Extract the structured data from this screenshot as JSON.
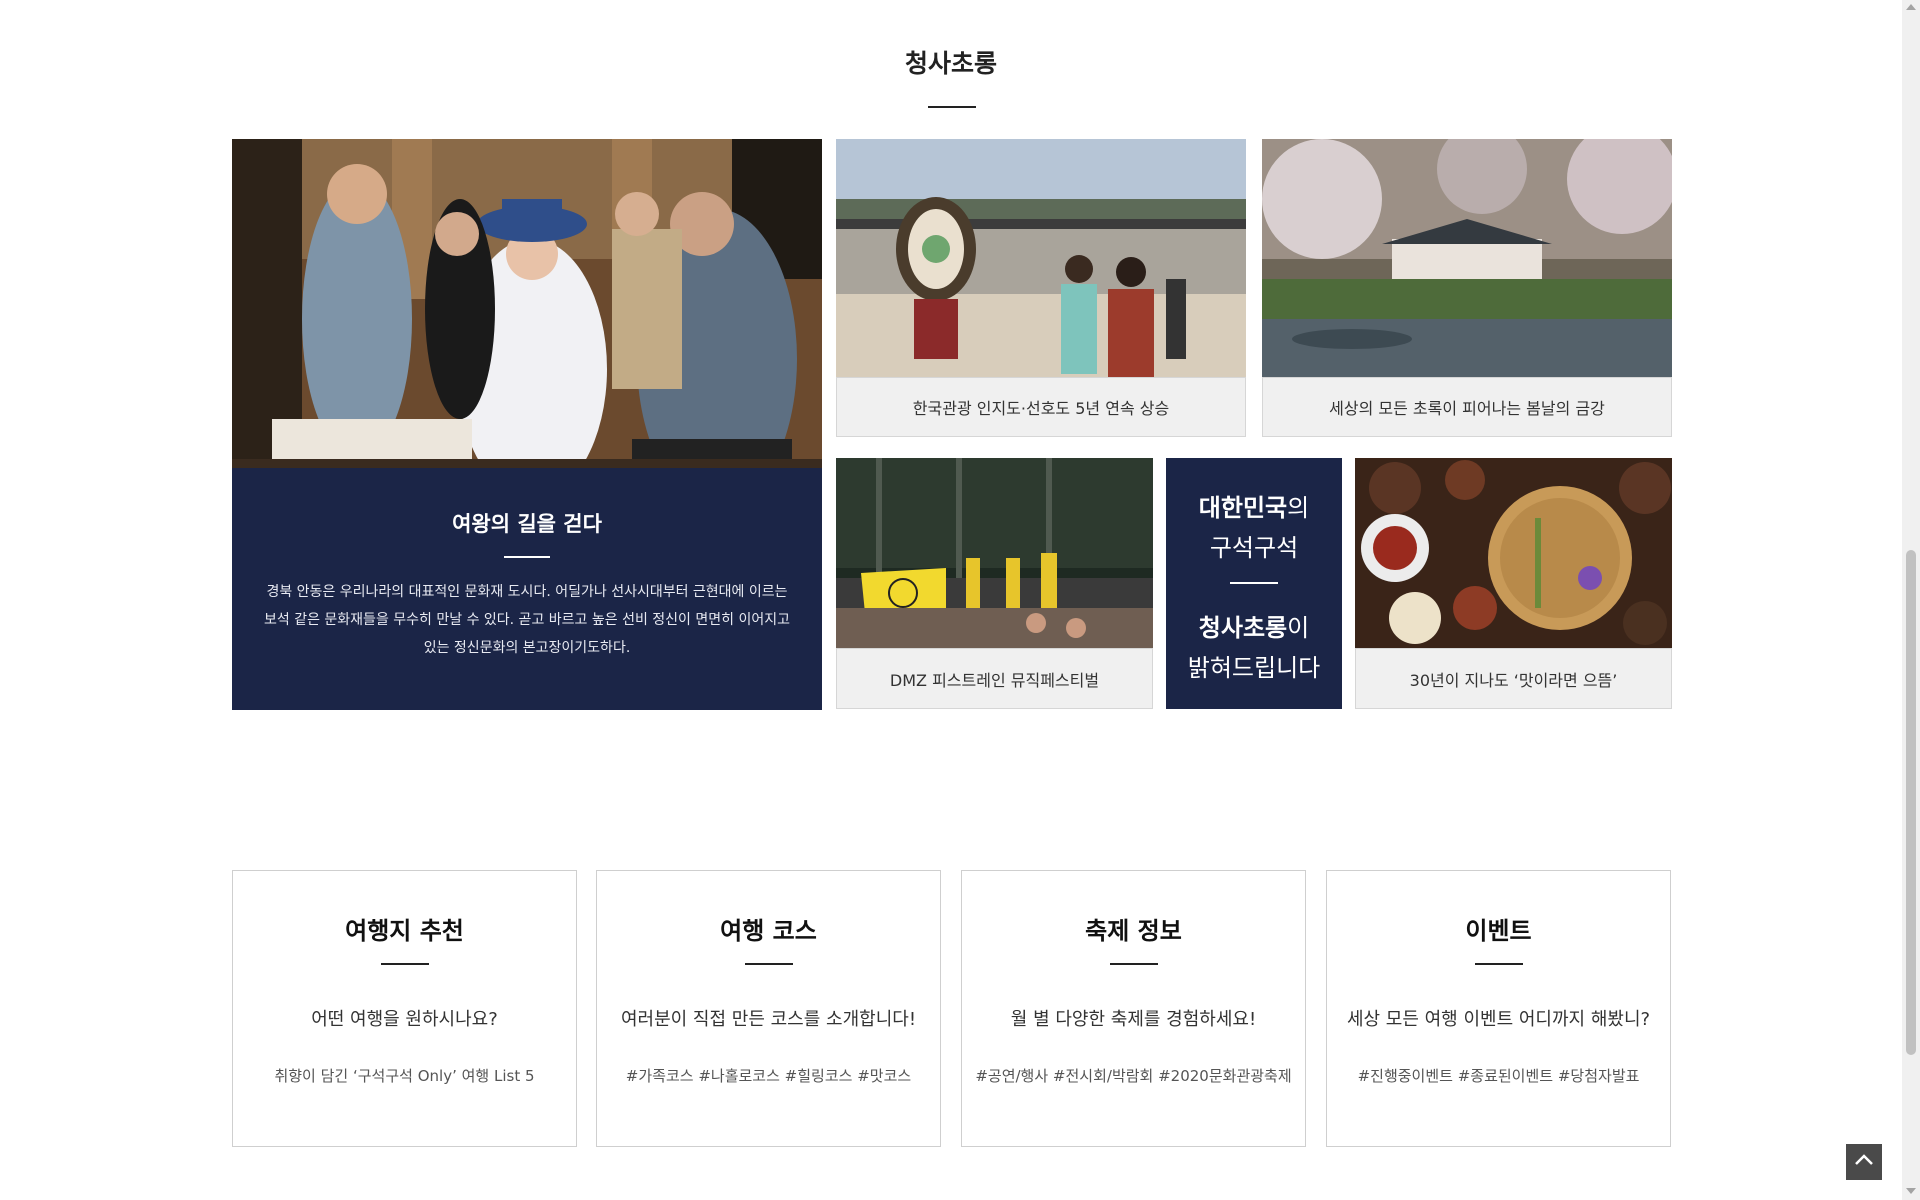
{
  "section": {
    "title": "청사초롱"
  },
  "feature": {
    "title": "여왕의 길을 걷다",
    "description": "경북 안동은 우리나라의 대표적인 문화재 도시다. 어딜가나 선사시대부터 근현대에 이르는 보석 같은 문화재들을 무수히 만날 수 있다. 곧고 바르고 높은 선비 정신이 면면히 이어지고 있는 정신문화의 본고장이기도하다."
  },
  "cards": [
    {
      "caption": "한국관광 인지도·선호도 5년 연속 상승"
    },
    {
      "caption": "세상의 모든 초록이 피어나는 봄날의 금강"
    },
    {
      "caption": "DMZ 피스트레인 뮤직페스티벌"
    },
    {
      "caption": "30년이 지나도 ‘맛이라면 으뜸’"
    }
  ],
  "slogan": {
    "line1_bold": "대한민국",
    "line1_rest": "의",
    "line2": "구석구석",
    "line3_bold": "청사초롱",
    "line3_rest": "이",
    "line4": "밝혀드립니다"
  },
  "info_cards": [
    {
      "title": "여행지 추천",
      "subtitle": "어떤 여행을 원하시나요?",
      "tags": "취향이 담긴 ‘구석구석 Only’ 여행 List 5"
    },
    {
      "title": "여행 코스",
      "subtitle": "여러분이 직접 만든 코스를 소개합니다!",
      "tags": "#가족코스 #나홀로코스 #힐링코스 #맛코스"
    },
    {
      "title": "축제 정보",
      "subtitle": "월 별 다양한 축제를 경험하세요!",
      "tags": "#공연/행사 #전시회/박람회 #2020문화관광축제"
    },
    {
      "title": "이벤트",
      "subtitle": "세상 모든 여행 이벤트 어디까지 해봤니?",
      "tags": "#진행중이벤트 #종료된이벤트 #당첨자발표"
    }
  ],
  "colors": {
    "navy": "#1b2547",
    "caption_bg": "#f0f0f0"
  },
  "icons": {
    "top_button": "chevron-up-icon"
  }
}
